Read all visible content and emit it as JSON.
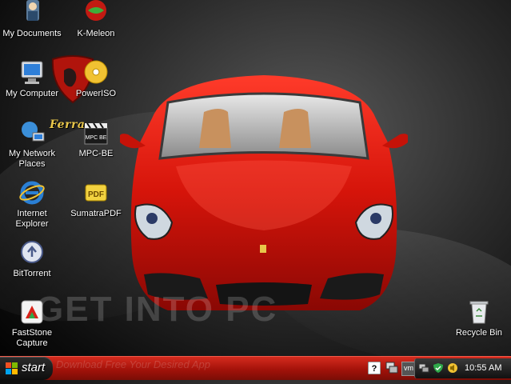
{
  "desktop_icons": [
    {
      "id": "my-documents",
      "label": "My Documents"
    },
    {
      "id": "k-meleon",
      "label": "K-Meleon"
    },
    {
      "id": "my-computer",
      "label": "My Computer"
    },
    {
      "id": "poweriso",
      "label": "PowerISO"
    },
    {
      "id": "my-network-places",
      "label": "My Network Places"
    },
    {
      "id": "mpc-be",
      "label": "MPC-BE"
    },
    {
      "id": "internet-explorer",
      "label": "Internet Explorer"
    },
    {
      "id": "sumatrapdf",
      "label": "SumatraPDF"
    },
    {
      "id": "bittorrent",
      "label": "BitTorrent"
    },
    {
      "id": "faststone-capture",
      "label": "FastStone Capture"
    },
    {
      "id": "recycle-bin",
      "label": "Recycle Bin"
    }
  ],
  "wallpaper": {
    "logo_text": "Ferra",
    "watermark": "GET INTO PC",
    "watermark_tagline": "Download Free Your Desired App",
    "mpc_label": "MPC BE",
    "pdf_label": "PDF"
  },
  "taskbar": {
    "start_label": "start",
    "clock": "10:55 AM",
    "vm_label": "vm",
    "colors": {
      "taskbar": "#c21d12",
      "start": "#1a1a1a",
      "tray": "#222222"
    }
  },
  "icons": {
    "start": "windows-flag-icon",
    "help": "help-icon",
    "windows": "switch-windows-icon",
    "vmware": "vmware-icon",
    "network": "network-icon",
    "security": "security-shield-icon",
    "volume": "volume-icon"
  }
}
